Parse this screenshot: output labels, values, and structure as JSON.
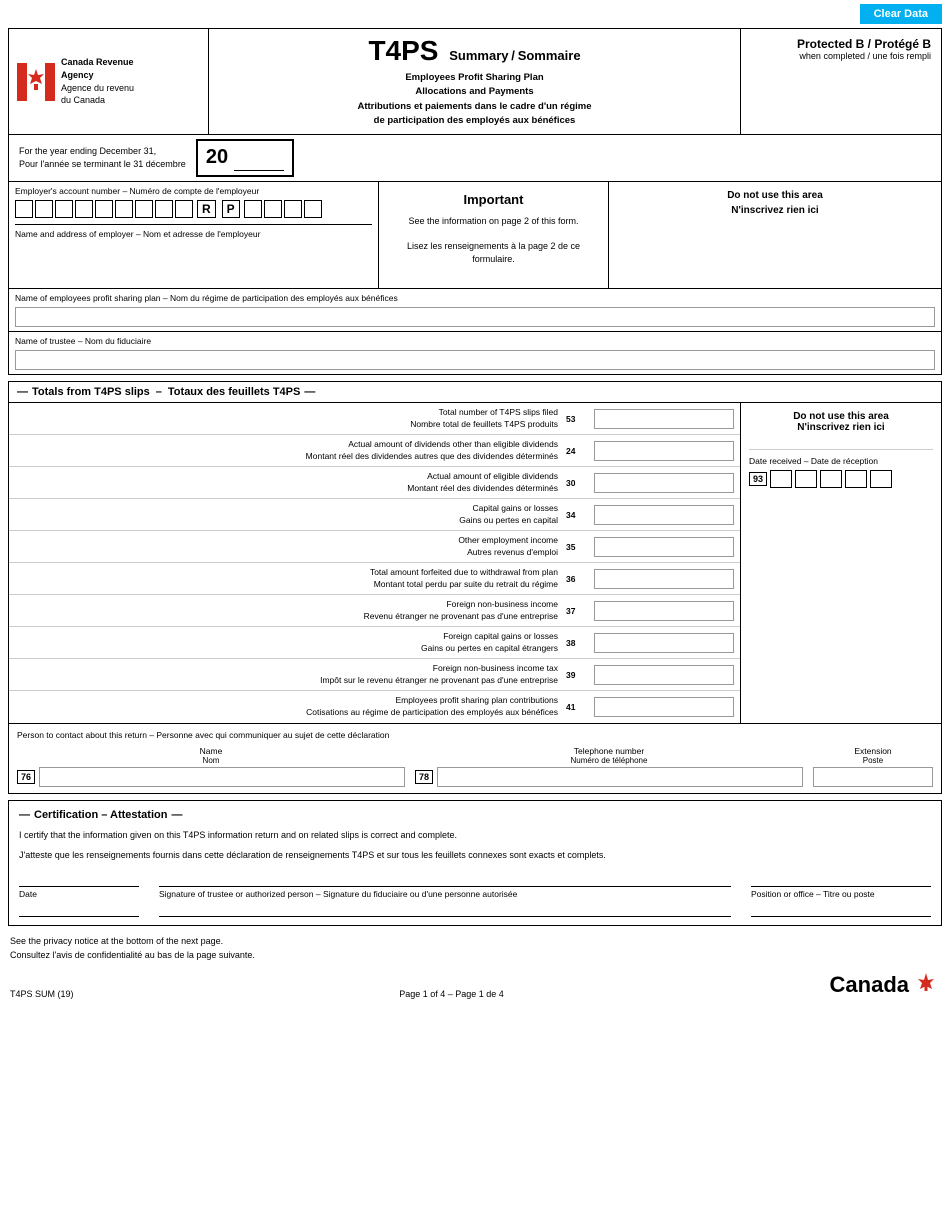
{
  "header": {
    "clear_data_label": "Clear Data",
    "logo_agency_en": "Canada Revenue",
    "logo_agency_en2": "Agency",
    "logo_agency_fr": "Agence du revenu",
    "logo_agency_fr2": "du Canada",
    "form_id": "T4PS",
    "summary_en": "Summary",
    "summary_fr": "Sommaire",
    "protected": "Protected B / Protégé B",
    "when_completed": "when completed / une fois rempli"
  },
  "year_section": {
    "label_en": "For the year ending December 31,",
    "label_fr": "Pour l'année se terminant le 31 décembre",
    "year": "20"
  },
  "form_description": {
    "line1_en": "Employees Profit Sharing Plan",
    "line2_en": "Allocations and Payments",
    "line3_fr": "Attributions et paiements dans le cadre d'un régime",
    "line4_fr": "de participation des employés aux bénéfices"
  },
  "employer_section": {
    "account_label": "Employer's account number – Numéro de compte de l'employeur",
    "rp_label": "R|P",
    "name_address_label": "Name and address of employer – Nom et adresse de l'employeur"
  },
  "important": {
    "title": "Important",
    "text_en": "See the information on page 2 of this form.",
    "text_fr": "Lisez les renseignements à la page 2 de ce formulaire."
  },
  "do_not_use": {
    "title_en": "Do not use this area",
    "title_fr": "N'inscrivez rien ici"
  },
  "epsp_section": {
    "label": "Name of employees profit sharing plan – Nom du régime de participation des employés aux bénéfices"
  },
  "trustee_section": {
    "label": "Name of trustee – Nom du fiduciaire"
  },
  "totals": {
    "header_en": "Totals from T4PS slips",
    "header_dash": "–",
    "header_fr": "Totaux des feuillets T4PS",
    "do_not_use_en": "Do not use this area",
    "do_not_use_fr": "N'inscrivez rien ici",
    "date_received_label": "Date received – Date de réception",
    "date_box_label": "93",
    "rows": [
      {
        "label_en": "Total number of T4PS slips filed",
        "label_fr": "Nombre total de feuillets T4PS produits",
        "box": "53"
      },
      {
        "label_en": "Actual amount of dividends other than eligible dividends",
        "label_fr": "Montant réel des dividendes autres que des dividendes déterminés",
        "box": "24"
      },
      {
        "label_en": "Actual amount of eligible dividends",
        "label_fr": "Montant réel des dividendes déterminés",
        "box": "30"
      },
      {
        "label_en": "Capital gains or losses",
        "label_fr": "Gains ou pertes en capital",
        "box": "34"
      },
      {
        "label_en": "Other employment income",
        "label_fr": "Autres revenus d'emploi",
        "box": "35"
      },
      {
        "label_en": "Total amount forfeited due to withdrawal from plan",
        "label_fr": "Montant total perdu par suite du retrait du régime",
        "box": "36"
      },
      {
        "label_en": "Foreign non-business income",
        "label_fr": "Revenu étranger ne provenant pas d'une entreprise",
        "box": "37"
      },
      {
        "label_en": "Foreign capital gains or losses",
        "label_fr": "Gains ou pertes en capital étrangers",
        "box": "38"
      },
      {
        "label_en": "Foreign non-business income tax",
        "label_fr": "Impôt sur le revenu étranger ne provenant pas d'une entreprise",
        "box": "39"
      },
      {
        "label_en": "Employees profit sharing plan contributions",
        "label_fr": "Cotisations au régime de participation des employés aux bénéfices",
        "box": "41"
      }
    ]
  },
  "contact": {
    "label": "Person to contact about this return – Personne avec qui communiquer au sujet de cette déclaration",
    "name_en": "Name",
    "name_fr": "Nom",
    "phone_en": "Telephone number",
    "phone_fr": "Numéro de téléphone",
    "ext_en": "Extension",
    "ext_fr": "Poste",
    "field_76": "76",
    "field_78": "78"
  },
  "certification": {
    "header": "Certification – Attestation",
    "text_en": "I certify that the information given on this T4PS information return and on related slips is correct and complete.",
    "text_fr": "J'atteste que les renseignements fournis dans cette déclaration de renseignements T4PS et sur tous les feuillets connexes sont exacts et complets.",
    "sig_date": "Date",
    "sig_trustee": "Signature of trustee or authorized person – Signature du fiduciaire ou d'une personne autorisée",
    "sig_position": "Position or office – Titre ou poste"
  },
  "footer": {
    "privacy_en": "See the privacy notice at the bottom of the next page.",
    "privacy_fr": "Consultez l'avis de confidentialité au bas de la page suivante.",
    "form_id": "T4PS SUM (19)",
    "page_info": "Page 1 of 4 – Page 1 de 4",
    "canada_wordmark": "Canada"
  }
}
